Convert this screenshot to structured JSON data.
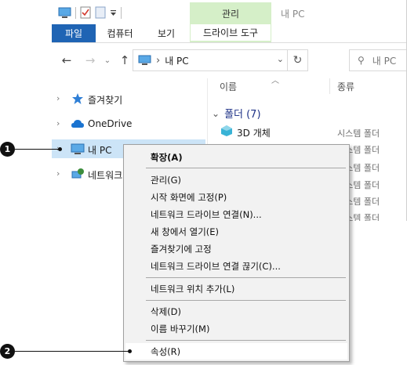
{
  "titlebar": {
    "contextual_tab": "관리",
    "window_title": "내 PC"
  },
  "ribbon": {
    "tabs": [
      "파일",
      "컴퓨터",
      "보기",
      "드라이브 도구"
    ]
  },
  "address": {
    "chevron": "›",
    "location": "내 PC",
    "search_placeholder": "내 PC"
  },
  "nav": {
    "items": [
      {
        "label": "즐겨찾기",
        "icon": "star-icon"
      },
      {
        "label": "OneDrive",
        "icon": "cloud-icon"
      },
      {
        "label": "내 PC",
        "icon": "computer-icon"
      },
      {
        "label": "네트워크",
        "icon": "network-icon"
      }
    ]
  },
  "content": {
    "col_name": "이름",
    "col_type": "종류",
    "group_label": "폴더 (7)",
    "files": [
      {
        "name": "3D 개체",
        "type": "시스템 폴더"
      },
      {
        "name": "",
        "type": "시스템 폴더"
      },
      {
        "name": "",
        "type": "시스템 폴더"
      },
      {
        "name": "",
        "type": "시스템 폴더"
      },
      {
        "name": "",
        "type": "시스템 폴더"
      },
      {
        "name": "",
        "type": "시스템 폴더"
      },
      {
        "name": "",
        "type": "시스템 폴더"
      }
    ]
  },
  "context_menu": {
    "items": [
      "확장(A)",
      "관리(G)",
      "시작 화면에 고정(P)",
      "네트워크 드라이브 연결(N)...",
      "새 창에서 열기(E)",
      "즐겨찾기에 고정",
      "네트워크 드라이브 연결 끊기(C)...",
      "네트워크 위치 추가(L)",
      "삭제(D)",
      "이름 바꾸기(M)",
      "속성(R)"
    ]
  },
  "callouts": [
    "1",
    "2"
  ],
  "colors": {
    "file_tab": "#1f64b4",
    "contextual_tab": "#d5efc8",
    "selection": "#cce4f7",
    "group_header": "#1e3287"
  }
}
